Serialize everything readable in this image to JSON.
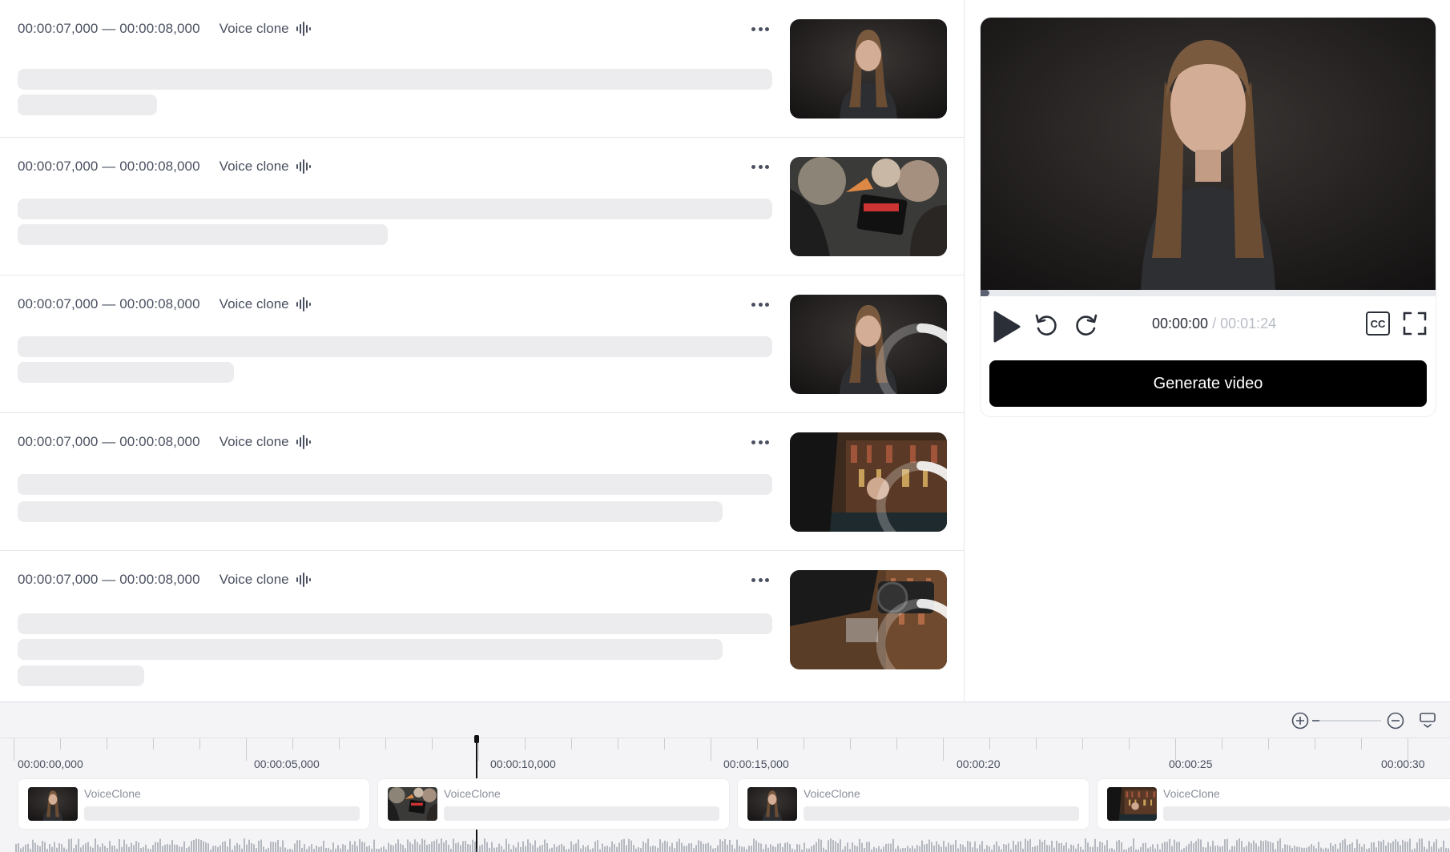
{
  "scenes": [
    {
      "time_range": "00:00:07,000 — 00:00:08,000",
      "voice_label": "Voice clone",
      "thumb": "portrait-woman",
      "loading": false
    },
    {
      "time_range": "00:00:07,000 — 00:00:08,000",
      "voice_label": "Voice clone",
      "thumb": "film-clapper",
      "loading": false
    },
    {
      "time_range": "00:00:07,000 — 00:00:08,000",
      "voice_label": "Voice clone",
      "thumb": "portrait-woman",
      "loading": true
    },
    {
      "time_range": "00:00:07,000 — 00:00:08,000",
      "voice_label": "Voice clone",
      "thumb": "library-set",
      "loading": true
    },
    {
      "time_range": "00:00:07,000 — 00:00:08,000",
      "voice_label": "Voice clone",
      "thumb": "camera-library",
      "loading": true
    }
  ],
  "preview": {
    "current_time": "00:00:00",
    "separator": "/",
    "total_time": "00:01:24",
    "progress": 0.02,
    "cc_label": "CC",
    "generate_label": "Generate video"
  },
  "timeline": {
    "zoom_level": 0.1,
    "labels": [
      "00:00:00,000",
      "00:00:05,000",
      "00:00:10,000",
      "00:00:15,000",
      "00:00:20",
      "00:00:25",
      "00:00:30"
    ],
    "clips": [
      {
        "name": "VoiceClone",
        "thumb": "portrait-woman"
      },
      {
        "name": "VoiceClone",
        "thumb": "film-clapper"
      },
      {
        "name": "VoiceClone",
        "thumb": "portrait-woman"
      },
      {
        "name": "VoiceClone",
        "thumb": "library-set"
      }
    ]
  },
  "icons": [
    "more-icon",
    "waveform-icon",
    "play-icon",
    "rewind-icon",
    "forward-icon",
    "cc-icon",
    "fullscreen-icon",
    "zoom-in-icon",
    "zoom-out-icon",
    "subtitle-toggle-icon"
  ],
  "colors": {
    "accent": "#000000",
    "skeleton": "#ececee",
    "timeline_bg": "#f4f4f6"
  }
}
